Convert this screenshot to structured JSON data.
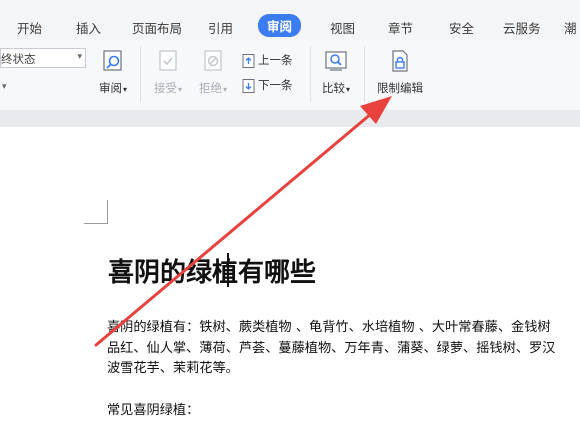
{
  "tabs": [
    {
      "label": "开始",
      "active": false
    },
    {
      "label": "插入",
      "active": false
    },
    {
      "label": "页面布局",
      "active": false
    },
    {
      "label": "引用",
      "active": false
    },
    {
      "label": "审阅",
      "active": true
    },
    {
      "label": "视图",
      "active": false
    },
    {
      "label": "章节",
      "active": false
    },
    {
      "label": "安全",
      "active": false
    },
    {
      "label": "云服务",
      "active": false
    },
    {
      "label": "潮",
      "active": false
    }
  ],
  "ribbon": {
    "status_dropdown": "终状态",
    "review_label": "审阅",
    "accept_label": "接受",
    "reject_label": "拒绝",
    "prev_label": "上一条",
    "next_label": "下一条",
    "compare_label": "比较",
    "restrict_label": "限制编辑"
  },
  "document": {
    "title_before_cursor": "喜阴的绿",
    "title_after_cursor": "植有哪些",
    "para_lines": [
      "喜阴的绿植有：铁树、蕨类植物 、龟背竹、水培植物 、大叶常春藤、金钱树",
      "品红、仙人掌、薄荷、芦荟、蔓藤植物、万年青、蒲葵、绿萝、摇钱树、罗汉",
      "波雪花芋、茉莉花等。"
    ],
    "next_heading": "常见喜阴绿植："
  },
  "colors": {
    "active_tab": "#3b7cf0",
    "annotation_arrow": "#e8413e"
  }
}
